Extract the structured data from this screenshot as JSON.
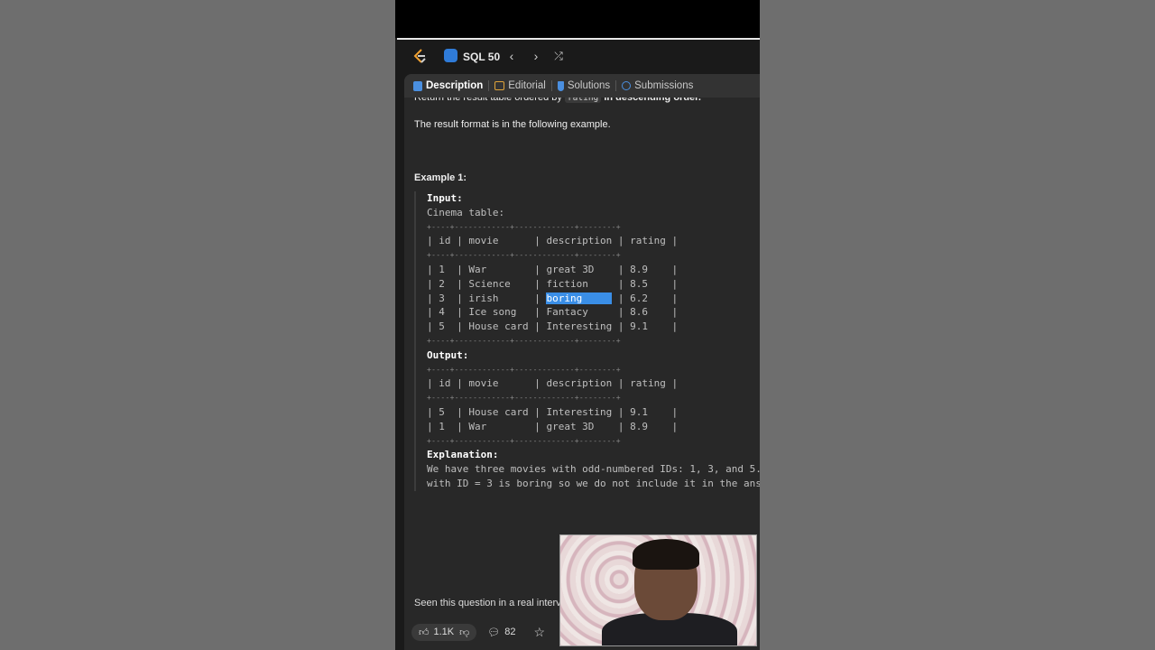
{
  "nav": {
    "study_plan": "SQL 50"
  },
  "tabs": [
    {
      "label": "Description",
      "active": true
    },
    {
      "label": "Editorial"
    },
    {
      "label": "Solutions"
    },
    {
      "label": "Submissions"
    }
  ],
  "content": {
    "cut_line_prefix": "Return the result table ordered by ",
    "cut_line_code": "rating",
    "cut_line_suffix": " in descending order.",
    "format_note": "The result format is in the following example.",
    "example_title": "Example 1:",
    "input_label": "Input:",
    "table_name": "Cinema table:",
    "border": "+----+------------+-------------+--------+",
    "input_header": "| id | movie      | description | rating |",
    "input_rows": [
      [
        "| 1  | War        | ",
        "great 3D   ",
        " | 8.9    |"
      ],
      [
        "| 2  | Science    | ",
        "fiction    ",
        " | 8.5    |"
      ],
      [
        "| 3  | irish      | ",
        "boring     ",
        " | 6.2    |"
      ],
      [
        "| 4  | Ice song   | ",
        "Fantacy    ",
        " | 8.6    |"
      ],
      [
        "| 5  | House card | ",
        "Interesting",
        " | 9.1    |"
      ]
    ],
    "output_label": "Output:",
    "output_header": "| id | movie      | description | rating |",
    "output_rows": [
      "| 5  | House card | Interesting | 9.1    |",
      "| 1  | War        | great 3D    | 8.9    |"
    ],
    "explanation_label": "Explanation:",
    "explanation_line1": "We have three movies with odd-numbered IDs: 1, 3, and 5.",
    "explanation_line2": "with ID = 3 is boring so we do not include it in the ans",
    "seen_question": "Seen this question in a real interv"
  },
  "footer": {
    "likes": "1.1K",
    "comments": "82"
  }
}
